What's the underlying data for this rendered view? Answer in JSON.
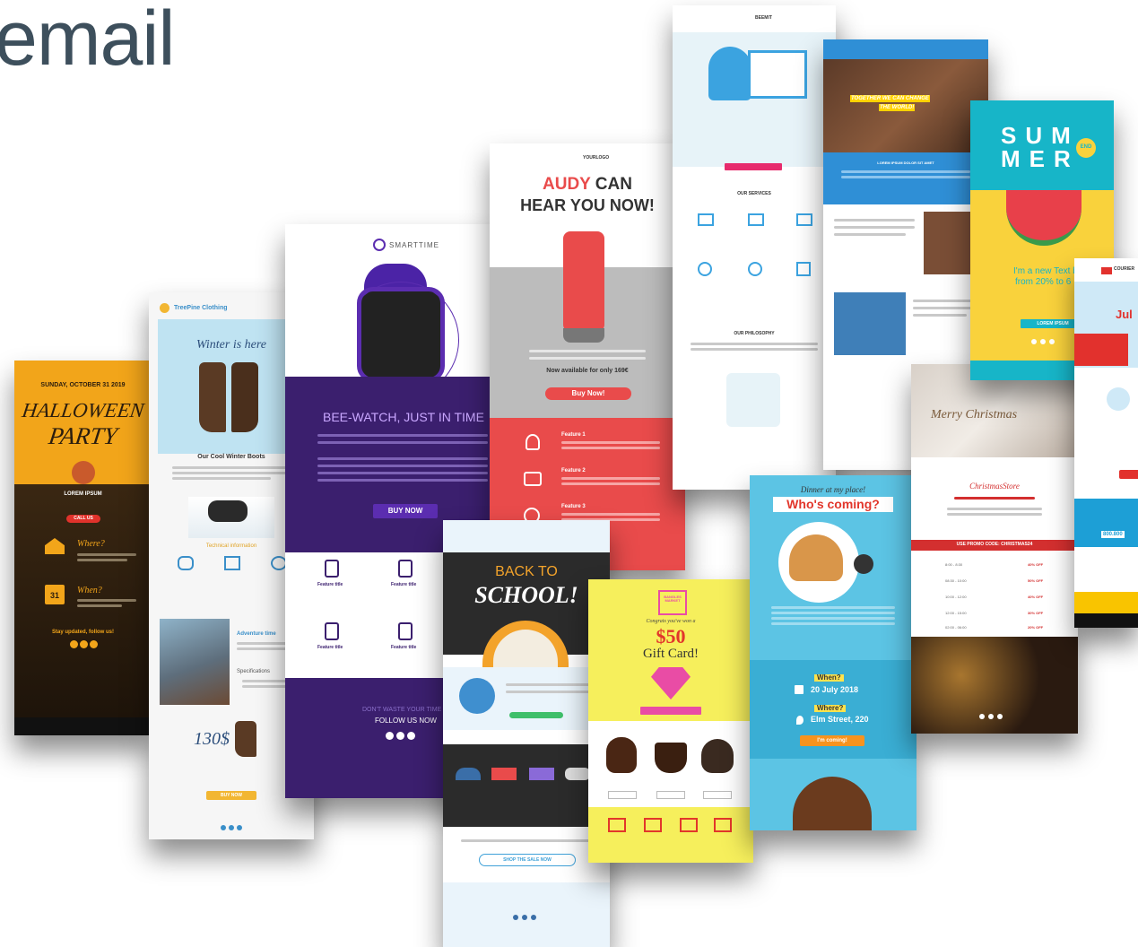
{
  "page": {
    "heading": "email"
  },
  "halloween": {
    "date": "SUNDAY, OCTOBER 31 2019",
    "title1": "HALLOWEEN",
    "title2": "PARTY",
    "lorem": "LOREM IPSUM",
    "cta": "CALL US",
    "where": "Where?",
    "when": "When?",
    "day": "31",
    "stay": "Stay updated, follow us!",
    "colors": {
      "bg": "#f2a51a",
      "dark": "#2b1d0e",
      "red": "#e0322b"
    }
  },
  "winter": {
    "brand": "TreePine Clothing",
    "headline": "Winter is here",
    "boots": "Our Cool Winter Boots",
    "info": "Technical information",
    "adventure": "Adventure time",
    "specs": "Specifications",
    "price": "130$",
    "cta": "BUY NOW",
    "colors": {
      "sky": "#bfe3f2",
      "accent": "#f2b632"
    }
  },
  "smart": {
    "brand": "SMARTTIME",
    "headline": "BEE-WATCH, JUST IN TIME",
    "cta": "BUY NOW",
    "follow_a": "DON'T WASTE YOUR TIME",
    "follow_b": "FOLLOW US NOW",
    "feature_title": "Feature title",
    "colors": {
      "purple": "#3b1f6e",
      "band": "#5b2db0"
    }
  },
  "audy": {
    "brand": "YOURLOGO",
    "headline_accent": "AUDY",
    "headline_a": " CAN",
    "headline_b": "HEAR YOU NOW!",
    "available": "Now available for only 169€",
    "cta": "Buy Now!",
    "features": [
      "Feature 1",
      "Feature 2",
      "Feature 3"
    ],
    "colors": {
      "red": "#e94b4b",
      "gray": "#bcbcbc"
    }
  },
  "school": {
    "headline_a": "BACK TO",
    "headline_b": "SCHOOL!",
    "shop_cta": "SHOP THE SALE NOW",
    "colors": {
      "dark": "#2b2b2b",
      "accent": "#f3a32b"
    }
  },
  "gift": {
    "brand": "BANGLES MARKET",
    "congrats": "Congrats you've won a",
    "amount": "$50",
    "label": "Gift Card!",
    "colors": {
      "yellow": "#f6ef5c",
      "pink": "#e94ca5",
      "red": "#e2362b"
    }
  },
  "dinner": {
    "intro": "Dinner at my place!",
    "headline": "Who's coming?",
    "when": "When?",
    "date": "20 July 2018",
    "where": "Where?",
    "address": "Elm Street, 220",
    "cta": "I'm coming!",
    "colors": {
      "blue": "#5cc4e4",
      "yellow": "#ffe34d",
      "orange": "#f7931e"
    }
  },
  "services": {
    "brand": "BEEMIT",
    "sections": [
      "OUR SERVICES",
      "OUR PHILOSOPHY"
    ],
    "colors": {
      "pink": "#e72b6d",
      "blue": "#3ba3e0"
    }
  },
  "children": {
    "banner_a": "TOGETHER WE CAN CHANGE",
    "banner_b": "THE WORLD!",
    "lorem": "LOREM IPSUM DOLOR SIT AMET",
    "colors": {
      "blue": "#2f8fd6",
      "yellow": "#ffd200"
    }
  },
  "christmas": {
    "title": "Merry Christmas",
    "store": "ChristmasStore",
    "promo": "USE PROMO CODE: CHRISTMAS24",
    "rows": [
      {
        "time": "8:00 - 8:30",
        "off": "40% OFF"
      },
      {
        "time": "08:30 - 10:00",
        "off": "50% OFF"
      },
      {
        "time": "10:00 - 12:00",
        "off": "40% OFF"
      },
      {
        "time": "12:00 - 15:00",
        "off": "30% OFF"
      },
      {
        "time": "02:00 - 06:00",
        "off": "20% OFF"
      }
    ],
    "colors": {
      "red": "#d32f2f"
    }
  },
  "summer": {
    "title_a": "SUM",
    "title_b": "MER",
    "badge": "END",
    "promo_a": "I'm a new Text bl",
    "promo_b": "from 20% to 6",
    "cta": "LOREM IPSUM",
    "colors": {
      "teal": "#17b5c8",
      "yellow": "#f9d23c"
    }
  },
  "courier": {
    "brand": "COURIER",
    "word": "Jul",
    "phone": "800.800",
    "colors": {
      "red": "#e2312d",
      "sky": "#cfe9f7"
    }
  }
}
